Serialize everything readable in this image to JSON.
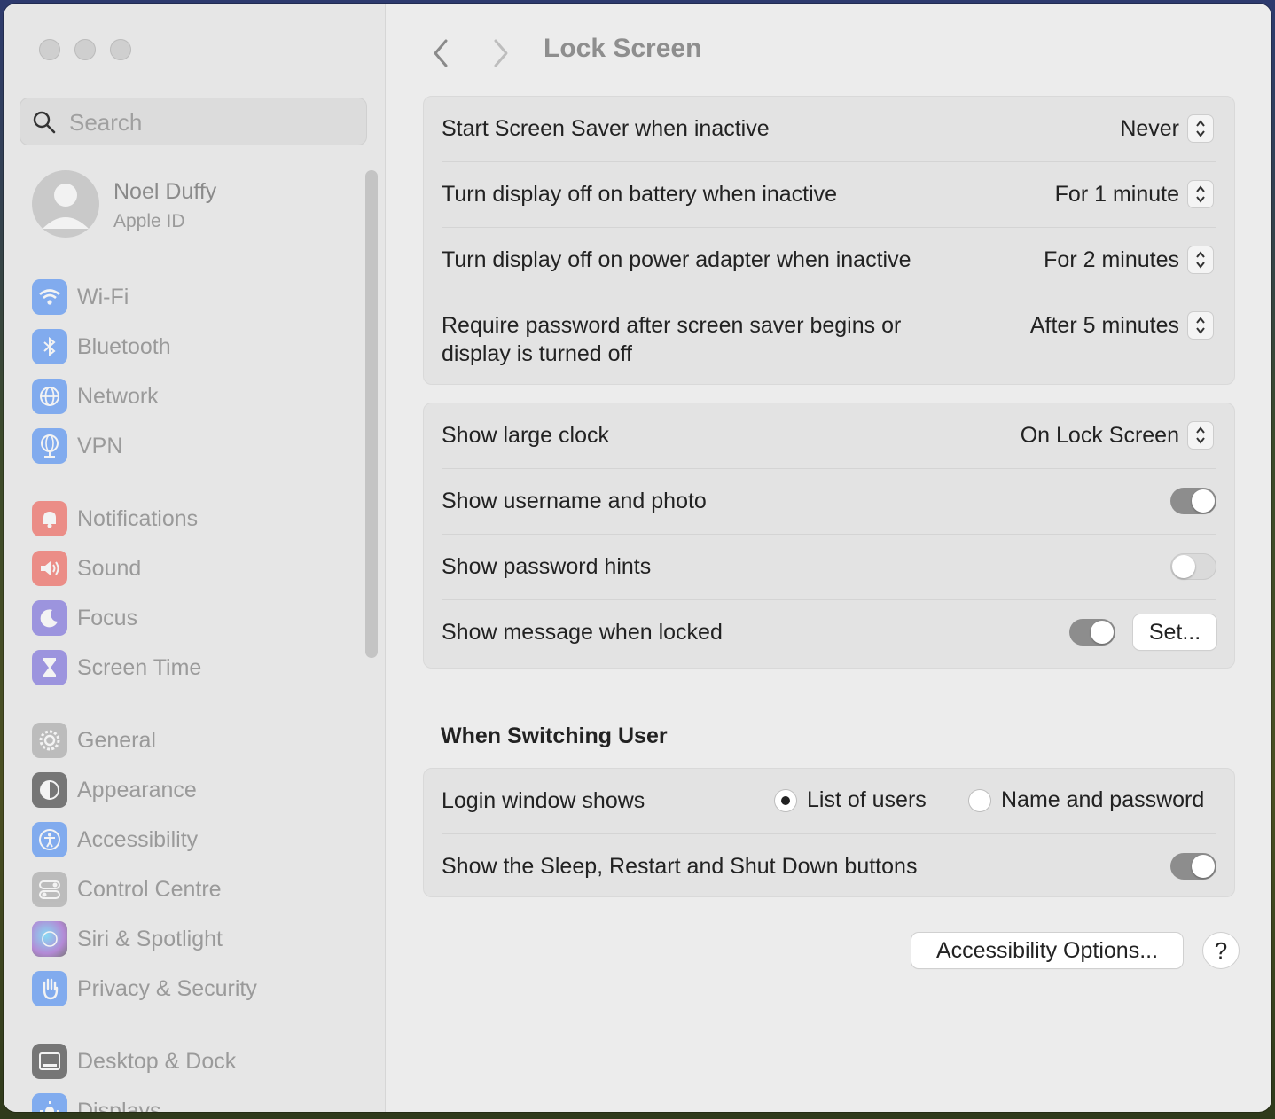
{
  "sidebar": {
    "search_placeholder": "Search",
    "account": {
      "name": "Noel Duffy",
      "subtitle": "Apple ID"
    },
    "items": [
      {
        "label": "Wi-Fi",
        "icon": "wifi-icon",
        "color": "#2f7cf6"
      },
      {
        "label": "Bluetooth",
        "icon": "bluetooth-icon",
        "color": "#2f7cf6"
      },
      {
        "label": "Network",
        "icon": "globe-icon",
        "color": "#2f7cf6"
      },
      {
        "label": "VPN",
        "icon": "vpn-globe-icon",
        "color": "#2f7cf6"
      },
      {
        "label": "Notifications",
        "icon": "bell-icon",
        "color": "#f0453a"
      },
      {
        "label": "Sound",
        "icon": "speaker-icon",
        "color": "#f0453a"
      },
      {
        "label": "Focus",
        "icon": "moon-icon",
        "color": "#6152d9"
      },
      {
        "label": "Screen Time",
        "icon": "hourglass-icon",
        "color": "#6152d9"
      },
      {
        "label": "General",
        "icon": "gear-icon",
        "color": "#9a9a9a"
      },
      {
        "label": "Appearance",
        "icon": "appearance-icon",
        "color": "#1c1c1c"
      },
      {
        "label": "Accessibility",
        "icon": "accessibility-icon",
        "color": "#2f7cf6"
      },
      {
        "label": "Control Centre",
        "icon": "switches-icon",
        "color": "#9a9a9a"
      },
      {
        "label": "Siri & Spotlight",
        "icon": "siri-icon",
        "color": "#8b3fc9"
      },
      {
        "label": "Privacy & Security",
        "icon": "hand-icon",
        "color": "#2f7cf6"
      },
      {
        "label": "Desktop & Dock",
        "icon": "dock-icon",
        "color": "#1c1c1c"
      },
      {
        "label": "Displays",
        "icon": "sun-icon",
        "color": "#2f7cf6"
      }
    ]
  },
  "header": {
    "title": "Lock Screen"
  },
  "group1": {
    "rows": [
      {
        "label": "Start Screen Saver when inactive",
        "value": "Never"
      },
      {
        "label": "Turn display off on battery when inactive",
        "value": "For 1 minute"
      },
      {
        "label": "Turn display off on power adapter when inactive",
        "value": "For 2 minutes"
      },
      {
        "label_line1": "Require password after screen saver begins or",
        "label_line2": "display is turned off",
        "value": "After 5 minutes"
      }
    ]
  },
  "group2": {
    "clock": {
      "label": "Show large clock",
      "value": "On Lock Screen"
    },
    "username": {
      "label": "Show username and photo",
      "on": true
    },
    "hints": {
      "label": "Show password hints",
      "on": false
    },
    "message": {
      "label": "Show message when locked",
      "on": true,
      "button": "Set..."
    }
  },
  "switching": {
    "title": "When Switching User",
    "login": {
      "label": "Login window shows",
      "option1": "List of users",
      "option2": "Name and password",
      "selected": "List of users"
    },
    "buttons": {
      "label": "Show the Sleep, Restart and Shut Down buttons",
      "on": true
    }
  },
  "footer": {
    "accessibility_button": "Accessibility Options...",
    "help": "?"
  }
}
